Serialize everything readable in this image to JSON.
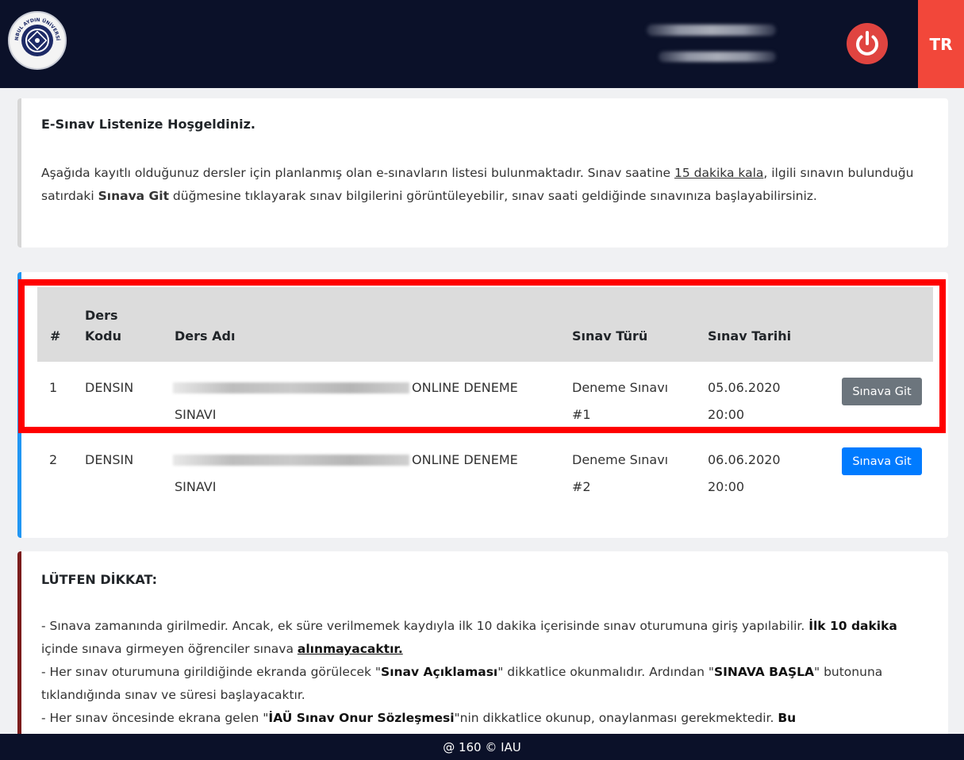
{
  "header": {
    "logo_text": "İSTANBUL AYDIN ÜNİVERSİTESİ",
    "lang": "TR",
    "colors": {
      "bg": "#0b1129",
      "power": "#e04440",
      "lang_bg": "#f2473a"
    }
  },
  "welcome": {
    "title": "E-Sınav Listenize Hoşgeldiniz.",
    "p1": "Aşağıda kayıtlı olduğunuz dersler için planlanmış olan e-sınavların listesi bulunmaktadır. Sınav saatine ",
    "p_link": "15 dakika kala",
    "p2": ", ilgili sınavın bulunduğu satırdaki ",
    "p_bold": "Sınava Git",
    "p3": " düğmesine tıklayarak sınav bilgilerini görüntüleyebilir, sınav saati geldiğinde sınavınıza başlayabilirsiniz."
  },
  "table": {
    "headers": {
      "num": "#",
      "code_l1": "Ders",
      "code_l2": "Kodu",
      "name": "Ders Adı",
      "type": "Sınav Türü",
      "date": "Sınav Tarihi"
    },
    "rows": [
      {
        "num": "1",
        "code": "DENSIN",
        "name_l1": "ONLINE DENEME",
        "name_l2": "SINAVI",
        "type_l1": "Deneme Sınavı",
        "type_l2": "#1",
        "date_l1": "05.06.2020",
        "date_l2": "20:00",
        "button": "Sınava Git"
      },
      {
        "num": "2",
        "code": "DENSIN",
        "name_l1": "ONLINE DENEME",
        "name_l2": "SINAVI",
        "type_l1": "Deneme Sınavı",
        "type_l2": "#2",
        "date_l1": "06.06.2020",
        "date_l2": "20:00",
        "button": "Sınava Git"
      }
    ]
  },
  "notice": {
    "title": "LÜTFEN DİKKAT:",
    "l1a": "- Sınava zamanında girilmedir. Ancak, ek süre verilmemek kaydıyla ilk 10 dakika içerisinde sınav oturumuna giriş yapılabilir. ",
    "l1b": "İlk 10 dakika",
    "l1c": " içinde sınava girmeyen öğrenciler sınava ",
    "l1d": "alınmayacaktır.",
    "l2a": "- Her sınav oturumuna girildiğinde ekranda görülecek \"",
    "l2b": "Sınav Açıklaması",
    "l2c": "\" dikkatlice okunmalıdır. Ardından \"",
    "l2d": "SINAVA BAŞLA",
    "l2e": "\" butonuna tıklandığında sınav ve süresi başlayacaktır.",
    "l3a": "- Her sınav öncesinde ekrana gelen \"",
    "l3b": "İAÜ Sınav Onur Sözleşmesi",
    "l3c": "\"nin dikkatlice okunup, onaylanması gerekmektedir. ",
    "l3d": "Bu"
  },
  "footer": {
    "text": "@ 160 © IAU"
  }
}
